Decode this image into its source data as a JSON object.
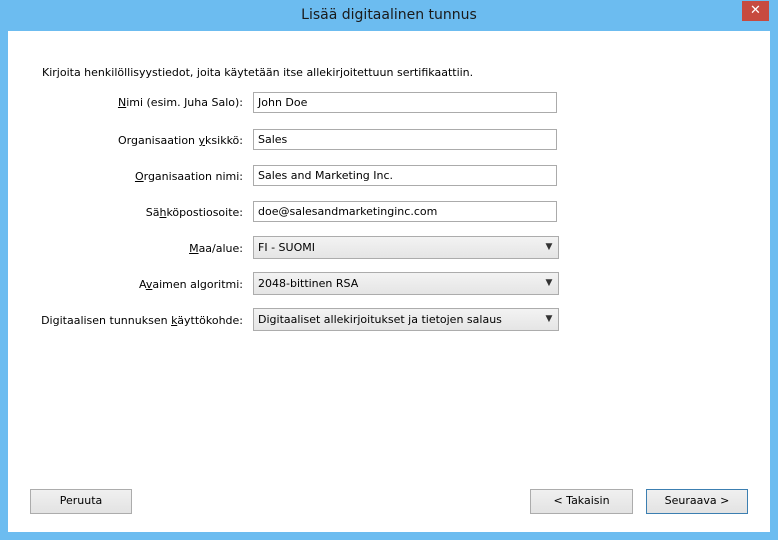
{
  "window": {
    "title": "Lisää digitaalinen tunnus",
    "close_glyph": "✕"
  },
  "form": {
    "intro": "Kirjoita henkilöllisyystiedot, joita käytetään itse allekirjoitettuun sertifikaattiin.",
    "name": {
      "label_pre": "",
      "label_mn": "N",
      "label_post": "imi (esim. Juha Salo):",
      "value": "John Doe"
    },
    "unit": {
      "label_pre": "Organisaation ",
      "label_mn": "y",
      "label_post": "ksikkö:",
      "value": "Sales"
    },
    "org": {
      "label_pre": "",
      "label_mn": "O",
      "label_post": "rganisaation nimi:",
      "value": "Sales and Marketing Inc."
    },
    "email": {
      "label_pre": "Sä",
      "label_mn": "h",
      "label_post": "köpostiosoite:",
      "value": "doe@salesandmarketinginc.com"
    },
    "country": {
      "label_pre": "",
      "label_mn": "M",
      "label_post": "aa/alue:",
      "value": "FI - SUOMI"
    },
    "algorithm": {
      "label_pre": "A",
      "label_mn": "v",
      "label_post": "aimen algoritmi:",
      "value": "2048-bittinen RSA"
    },
    "usage": {
      "label_pre": "Digitaalisen tunnuksen ",
      "label_mn": "k",
      "label_post": "äyttökohde:",
      "value": "Digitaaliset allekirjoitukset ja tietojen salaus"
    }
  },
  "buttons": {
    "cancel": "Peruuta",
    "back": "< Takaisin",
    "next": "Seuraava >"
  },
  "icons": {
    "dropdown": "chevron-down-icon",
    "close": "close-icon"
  }
}
